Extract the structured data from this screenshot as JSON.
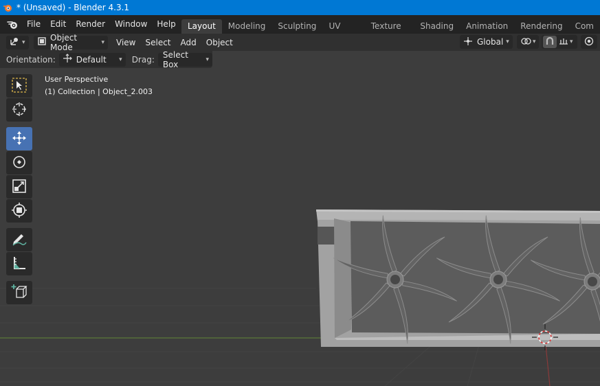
{
  "window": {
    "title": "* (Unsaved) - Blender 4.3.1"
  },
  "menu": [
    "File",
    "Edit",
    "Render",
    "Window",
    "Help"
  ],
  "workspaces": [
    "Layout",
    "Modeling",
    "Sculpting",
    "UV Editing",
    "Texture Paint",
    "Shading",
    "Animation",
    "Rendering",
    "Com"
  ],
  "active_workspace": "Layout",
  "header": {
    "mode": "Object Mode",
    "menus": [
      "View",
      "Select",
      "Add",
      "Object"
    ],
    "transform_orientation": "Global"
  },
  "tool_settings": {
    "orientation_label": "Orientation:",
    "orientation_value": "Default",
    "drag_label": "Drag:",
    "drag_value": "Select Box"
  },
  "viewport": {
    "perspective": "User Perspective",
    "collection": "(1) Collection | Object_2.003"
  },
  "tools": [
    "select-box-tool",
    "cursor-tool",
    "move-tool",
    "rotate-tool",
    "scale-tool",
    "transform-tool",
    "annotate-tool",
    "measure-tool",
    "add-cube-tool"
  ],
  "active_tool": "move-tool",
  "colors": {
    "titlebar": "#0078d4",
    "accent": "#4772b3",
    "viewport_bg": "#3d3d3d",
    "model": "#a4a4a4"
  }
}
